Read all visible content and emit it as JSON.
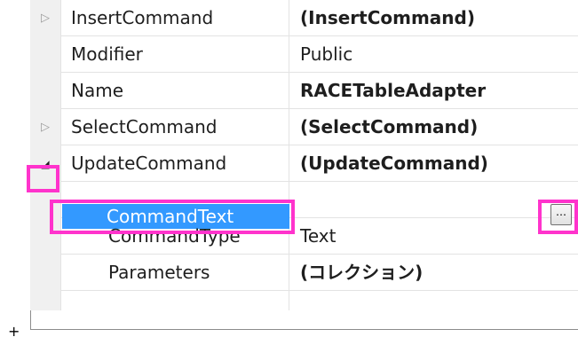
{
  "properties": [
    {
      "name": "InsertCommand",
      "value": "(InsertCommand)"
    },
    {
      "name": "Modifier",
      "value": "Public"
    },
    {
      "name": "Name",
      "value": "RACETableAdapter"
    },
    {
      "name": "SelectCommand",
      "value": "(SelectCommand)"
    },
    {
      "name": "UpdateCommand",
      "value": "(UpdateCommand)"
    },
    {
      "name": "CommandText",
      "value": ""
    },
    {
      "name": "CommandType",
      "value": "Text"
    },
    {
      "name": "Parameters",
      "value": "(コレクション)"
    }
  ],
  "icons": {
    "collapsed": "▷",
    "expanded": "◢",
    "ellipsis": "…",
    "corner": "+"
  },
  "colors": {
    "selection": "#3399ff",
    "highlight": "#ff33cc",
    "gutter": "#f0f0f0"
  }
}
